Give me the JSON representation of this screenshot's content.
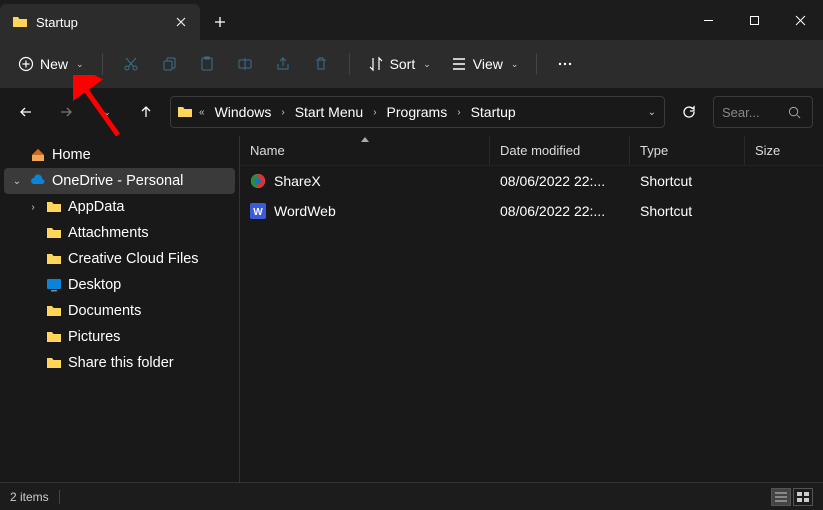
{
  "window": {
    "tab_title": "Startup",
    "minimize": "—",
    "maximize": "▢",
    "close": "✕"
  },
  "toolbar": {
    "new_label": "New",
    "sort_label": "Sort",
    "view_label": "View"
  },
  "breadcrumb": {
    "segments": [
      "Windows",
      "Start Menu",
      "Programs",
      "Startup"
    ]
  },
  "search": {
    "placeholder": "Sear..."
  },
  "sidebar": {
    "home": "Home",
    "onedrive": "OneDrive - Personal",
    "items": [
      "AppData",
      "Attachments",
      "Creative Cloud Files",
      "Desktop",
      "Documents",
      "Pictures",
      "Share this folder"
    ]
  },
  "columns": {
    "name": "Name",
    "date": "Date modified",
    "type": "Type",
    "size": "Size"
  },
  "rows": [
    {
      "name": "ShareX",
      "date": "08/06/2022 22:...",
      "type": "Shortcut"
    },
    {
      "name": "WordWeb",
      "date": "08/06/2022 22:...",
      "type": "Shortcut"
    }
  ],
  "status": {
    "count": "2 items"
  }
}
